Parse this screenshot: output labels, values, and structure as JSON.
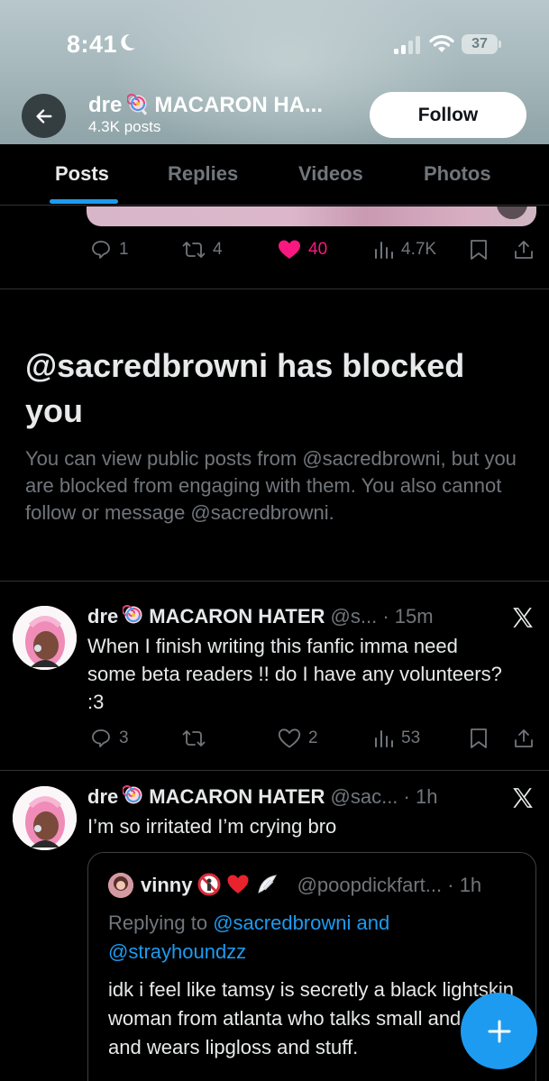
{
  "status_bar": {
    "time": "8:41",
    "battery": "37"
  },
  "header": {
    "name_prefix": "dre",
    "name_suffix": "MACARON HA...",
    "post_count": "4.3K posts",
    "follow_label": "Follow"
  },
  "tabs": [
    "Posts",
    "Replies",
    "Videos",
    "Photos"
  ],
  "active_tab": "Posts",
  "prev_tweet": {
    "replies": "1",
    "reposts": "4",
    "likes": "40",
    "views": "4.7K",
    "like_color": "#f91880"
  },
  "blocked": {
    "title": "@sacredbrowni has blocked you",
    "body": "You can view public posts from @sacredbrowni, but you are blocked from engaging with them. You also cannot follow or message @sacredbrowni."
  },
  "tweets": [
    {
      "name_prefix": "dre",
      "name_suffix": "MACARON HATER",
      "handle": "@s...",
      "time": "· 15m",
      "text": "When I finish writing this fanfic imma need some beta readers !! do I have any volunteers? :3",
      "replies": "3",
      "reposts": "",
      "likes": "2",
      "views": "53"
    },
    {
      "name_prefix": "dre",
      "name_suffix": "MACARON HATER",
      "handle": "@sac...",
      "time": "· 1h",
      "text": "I’m so irritated I’m crying bro",
      "quote": {
        "name": "vinny",
        "handle": "@poopdickfart...",
        "time": "· 1h",
        "replying_prefix": "Replying to",
        "mention_1": "@sacredbrowni and",
        "mention_2": "@strayhoundzz",
        "text": "idk i feel like tamsy is secretly a black lightskin woman from atlanta who talks small and cute and wears lipgloss and stuff."
      }
    }
  ],
  "colors": {
    "accent": "#1d9bf0",
    "secondary_text": "#71767b",
    "like": "#f91880"
  },
  "icons": [
    "back-arrow-icon",
    "lollipop-icon",
    "reply-icon",
    "repost-icon",
    "heart-icon",
    "views-icon",
    "bookmark-icon",
    "share-icon",
    "x-logo-icon",
    "plus-icon"
  ]
}
